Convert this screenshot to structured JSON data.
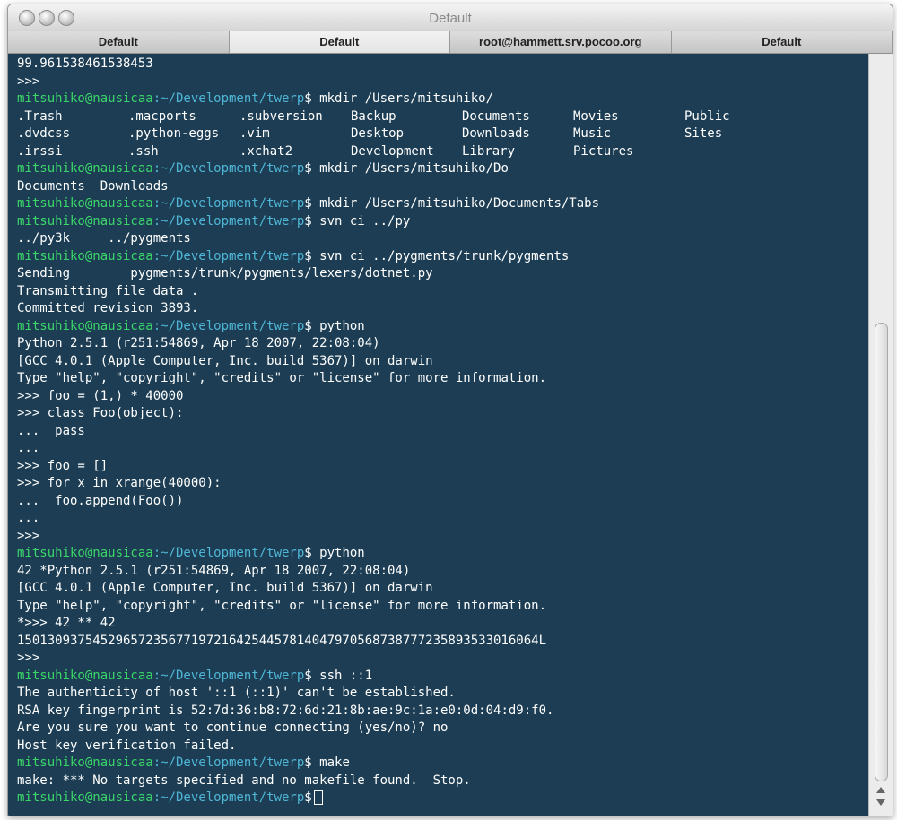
{
  "window": {
    "title": "Default",
    "tabs": [
      {
        "label": "Default",
        "active": false
      },
      {
        "label": "Default",
        "active": true
      },
      {
        "label": "root@hammett.srv.pocoo.org",
        "active": false
      },
      {
        "label": "Default",
        "active": false
      }
    ]
  },
  "prompt": {
    "user": "mitsuhiko@nausicaa",
    "path": ":~/Development/twerp",
    "symbol": "$"
  },
  "terminal": {
    "l1": "99.961538461538453",
    "l2": ">>>",
    "cmd1": " mkdir /Users/mitsuhiko/",
    "ls": [
      [
        ".Trash",
        ".dvdcss",
        ".irssi"
      ],
      [
        ".macports",
        ".python-eggs",
        ".ssh"
      ],
      [
        ".subversion",
        ".vim",
        ".xchat2"
      ],
      [
        "Backup",
        "Desktop",
        "Development"
      ],
      [
        "Documents",
        "Downloads",
        "Library"
      ],
      [
        "Movies",
        "Music",
        "Pictures"
      ],
      [
        "Public",
        "Sites",
        ""
      ]
    ],
    "cmd2": " mkdir /Users/mitsuhiko/Do",
    "l_docs": "Documents  Downloads",
    "cmd3": " mkdir /Users/mitsuhiko/Documents/Tabs",
    "cmd4": " svn ci ../py",
    "l_py": "../py3k     ../pygments",
    "cmd5": " svn ci ../pygments/trunk/pygments",
    "l_send": "Sending        pygments/trunk/pygments/lexers/dotnet.py",
    "l_trans": "Transmitting file data .",
    "l_commit": "Committed revision 3893.",
    "cmd6": " python",
    "py1": "Python 2.5.1 (r251:54869, Apr 18 2007, 22:08:04)",
    "py2": "[GCC 4.0.1 (Apple Computer, Inc. build 5367)] on darwin",
    "py3": "Type \"help\", \"copyright\", \"credits\" or \"license\" for more information.",
    "py4": ">>> foo = (1,) * 40000",
    "py5": ">>> class Foo(object):",
    "py6": "...  pass",
    "py7": "...",
    "py8": ">>> foo = []",
    "py9": ">>> for x in xrange(40000):",
    "py10": "...  foo.append(Foo())",
    "py11": "...",
    "py12": ">>>",
    "cmd7": " python",
    "p2_1": "42 *Python 2.5.1 (r251:54869, Apr 18 2007, 22:08:04)",
    "p2_2": "[GCC 4.0.1 (Apple Computer, Inc. build 5367)] on darwin",
    "p2_3": "Type \"help\", \"copyright\", \"credits\" or \"license\" for more information.",
    "p2_4": "*>>> 42 ** 42",
    "p2_5": "150130937545296572356771972164254457814047970568738777235893533016064L",
    "p2_6": ">>>",
    "cmd8": " ssh ::1",
    "ssh1": "The authenticity of host '::1 (::1)' can't be established.",
    "ssh2": "RSA key fingerprint is 52:7d:36:b8:72:6d:21:8b:ae:9c:1a:e0:0d:04:d9:f0.",
    "ssh3": "Are you sure you want to continue connecting (yes/no)? no",
    "ssh4": "Host key verification failed.",
    "cmd9": " make",
    "make1": "make: *** No targets specified and no makefile found.  Stop."
  },
  "colors": {
    "background": "#1c3d53",
    "user": "#3bd66a",
    "path": "#4fb6d6",
    "text": "#ffffff"
  }
}
